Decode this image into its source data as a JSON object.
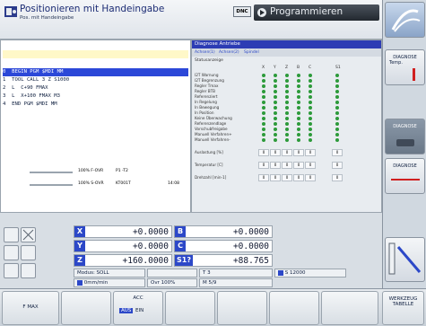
{
  "header": {
    "title": "Positionieren mit Handeingabe",
    "subtitle": "Pos. mit Handeingabe",
    "dnc": "DNC",
    "programming": "Programmieren"
  },
  "program": {
    "lines": [
      "0  BEGIN PGM $MDI MM",
      "1  TOOL CALL 3 Z S1000",
      "2  L  C+90 FMAX",
      "3  L  X+100 FMAX M3",
      "4  END PGM $MDI MM"
    ],
    "feed_override": "100% F-OVR",
    "feed_extra": "P1  -T2",
    "spindle_override": "100% S-OVR",
    "spindle_extra": "KT001T",
    "time": "14:08"
  },
  "diagnose": {
    "title": "Diagnose Antriebe",
    "tabs": [
      "Achsen(1)",
      "Achsen(2)",
      "Spindel"
    ],
    "status_label": "Statusanzeige",
    "axes": [
      "X",
      "Y",
      "Z",
      "B",
      "C",
      "S1"
    ],
    "status_rows": [
      "I2T Warnung",
      "I2T Begrenzung",
      "Regler Tmax",
      "Regler BTB",
      "Referenziert",
      "In Regelung",
      "In Bewegung",
      "In Position",
      "Keine Überwachung",
      "Referenzendlage",
      "Vorschubfreigabe",
      "Manuell Verfahren+",
      "Manuell Verfahren-"
    ],
    "value_rows": [
      {
        "label": "Auslastung [%]",
        "values": [
          "0",
          "0",
          "0",
          "0",
          "0",
          "0"
        ]
      },
      {
        "label": "Temperatur [C]",
        "values": [
          "0",
          "0",
          "0",
          "0",
          "0",
          "0"
        ]
      },
      {
        "label": "Drehzahl [min-1]",
        "values": [
          "0",
          "0",
          "0",
          "0",
          "0",
          "0"
        ]
      }
    ]
  },
  "positions": {
    "rows": [
      {
        "name": "X",
        "value": "+0.0000"
      },
      {
        "name": "Y",
        "value": "+0.0000"
      },
      {
        "name": "Z",
        "value": "+160.0000"
      },
      {
        "name": "B",
        "value": "+0.0000"
      },
      {
        "name": "C",
        "value": "+0.0000"
      },
      {
        "name": "S1?",
        "value": "+88.765"
      }
    ],
    "mode": "Modus: SOLL",
    "feed_unit": "0mm/min",
    "t_label": "T 3",
    "ovr": "Ovr 100%",
    "m_label": "M 5/9",
    "s_value": "S 12000"
  },
  "softkeys": {
    "fmax": "F MAX",
    "acc": "ACC",
    "aus": "AUS",
    "ein": "EIN",
    "werkzeug": "WERKZEUG",
    "tabelle": "TABELLE"
  },
  "side": {
    "diag_temp": "DIAGNOSE",
    "temp": "Temp.",
    "diag_antriebe": "DIAGNOSE",
    "diag_io": "DIAGNOSE"
  },
  "colors": {
    "selection": "#2c48d8",
    "axis_label_bg": "#2c48c8",
    "led_green": "#2c9a3a"
  }
}
